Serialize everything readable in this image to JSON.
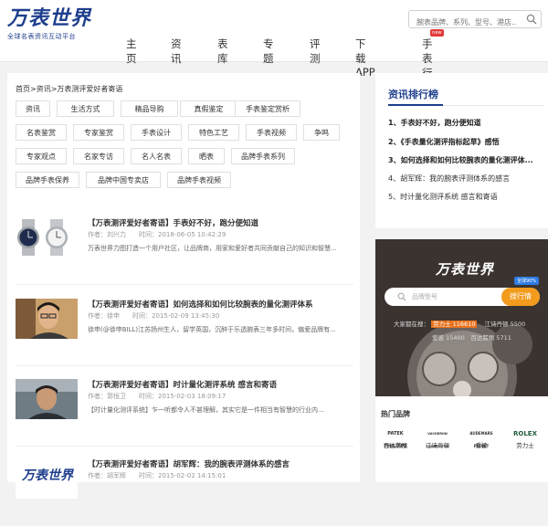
{
  "header": {
    "logo_main": "万表世界",
    "logo_sub": "全球名表资讯互动平台",
    "search_placeholder": "腕表品牌、系列、型号、港店..."
  },
  "nav": {
    "items": [
      "主页",
      "资讯",
      "表库",
      "专题",
      "评测",
      "下载APP",
      "手表行情"
    ],
    "hot_badge": "new"
  },
  "breadcrumb": "首页>资讯>万表测评爱好者寄语",
  "tags": [
    "资讯",
    "生活方式",
    "精品导购",
    "真假鉴定",
    "手表鉴定赏析",
    "名表鉴赏",
    "专家鉴赏",
    "手表设计",
    "特色工艺",
    "手表视频",
    "争鸣",
    "专家观点",
    "名家专访",
    "名人名表",
    "晒表",
    "品牌手表系列",
    "品牌手表保养",
    "品牌中国专卖店",
    "品牌手表视频"
  ],
  "articles": [
    {
      "title": "【万表测评爱好者寄语】手表好不好，跑分便知道",
      "meta": "作者：刘兴力　　时间：2018-06-05 10:42:29",
      "summary": "万表世界力图打造一个用户社区，让品牌商，用家和爱好者共同贡献自己的知识和智慧..."
    },
    {
      "title": "【万表测评爱好者寄语】如何选择和如何比较腕表的量化测评体系",
      "meta": "作者：徐申　　时间：2015-02-09 13:45:30",
      "summary": "徐申(@徐申BILL)江苏扬州生人，留学英国，沉醉于乐透腕表三年多时间，偏爱品牌有..."
    },
    {
      "title": "【万表测评爱好者寄语】时计量化测评系统 感言和寄语",
      "meta": "作者：郭恒卫　　时间：2015-02-03 18:09:17",
      "summary": "【时计量化测评系统】乍一听都令人不甚理解，其实它是一件相当有智慧的行业内..."
    },
    {
      "title": "【万表测评爱好者寄语】胡军辉：我的腕表评测体系的感言",
      "meta": "作者：胡军辉　　时间：2015-02-02 14:15:01",
      "summary": ""
    }
  ],
  "ranking": {
    "title": "资讯排行榜",
    "items": [
      "1、手表好不好，跑分便知道",
      "2、《手表量化测评指标起草》感悟",
      "3、如何选择和如何比较腕表的量化测评体...",
      "4、胡军辉：我的腕表评测体系的感言",
      "5、时计量化测评系统 感言和寄语"
    ]
  },
  "promo": {
    "logo": "万表世界",
    "badge": "全球90%",
    "search_placeholder": "品牌型号",
    "search_button": "搜行情",
    "line1_prefix": "大家都在搜：",
    "line1_hl": "劳力士 116610",
    "line1_suffix": "江诗丹顿 5500",
    "line2": "爱彼 15400　百达翡丽 5711",
    "hot_title": "热门品牌",
    "brands": [
      {
        "mark": "PATEK PHILIPPE",
        "name": "百达翡丽"
      },
      {
        "mark": "VACHERON CONSTANTIN",
        "name": "江诗丹顿"
      },
      {
        "mark": "AUDEMARS PIGUET",
        "name": "爱彼"
      },
      {
        "mark": "ROLEX",
        "name": "劳力士"
      }
    ]
  },
  "footer_logo": "万表世界"
}
